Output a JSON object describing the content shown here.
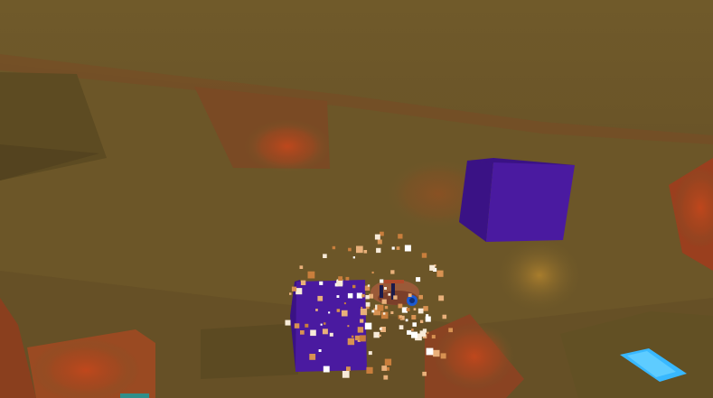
{
  "scene": {
    "type": "3d-cave-flight",
    "colors": {
      "cave_wall": "#6f5a2a",
      "cave_wall_dark": "#5c4a22",
      "lava_glow": "#c2471c",
      "obstacle_cube": "#4a1aa0",
      "obstacle_cube_side": "#3a1285",
      "pad": "#38b8ff",
      "particle": "#f3d8b4"
    },
    "objects": [
      {
        "name": "purple-cube-large",
        "kind": "obstacle"
      },
      {
        "name": "purple-cube-near",
        "kind": "obstacle"
      },
      {
        "name": "player-ship",
        "kind": "player"
      },
      {
        "name": "glowing-pad",
        "kind": "pickup-pad"
      },
      {
        "name": "explosion-particles",
        "kind": "effect"
      }
    ]
  }
}
